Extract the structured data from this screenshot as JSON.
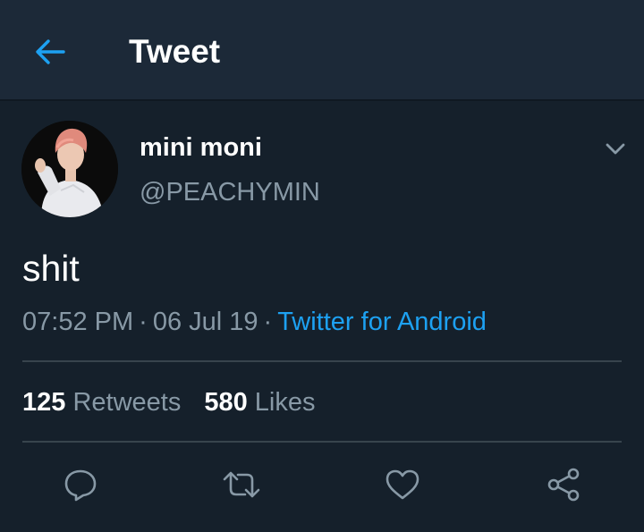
{
  "header": {
    "title": "Tweet",
    "back_icon": "arrow-left-icon"
  },
  "tweet": {
    "author": {
      "display_name": "mini moni",
      "handle": "@PEACHYMIN"
    },
    "text": "shit",
    "time": "07:52 PM",
    "separator": "·",
    "date": "06 Jul 19",
    "source": "Twitter for Android",
    "stats": {
      "retweets_count": "125",
      "retweets_label": "Retweets",
      "likes_count": "580",
      "likes_label": "Likes"
    }
  },
  "actions": [
    "reply-icon",
    "retweet-icon",
    "like-icon",
    "share-icon"
  ],
  "colors": {
    "background": "#15202b",
    "header_background": "#1c2938",
    "accent": "#1da1f2",
    "secondary_text": "#8899a6",
    "divider": "#38444d"
  }
}
